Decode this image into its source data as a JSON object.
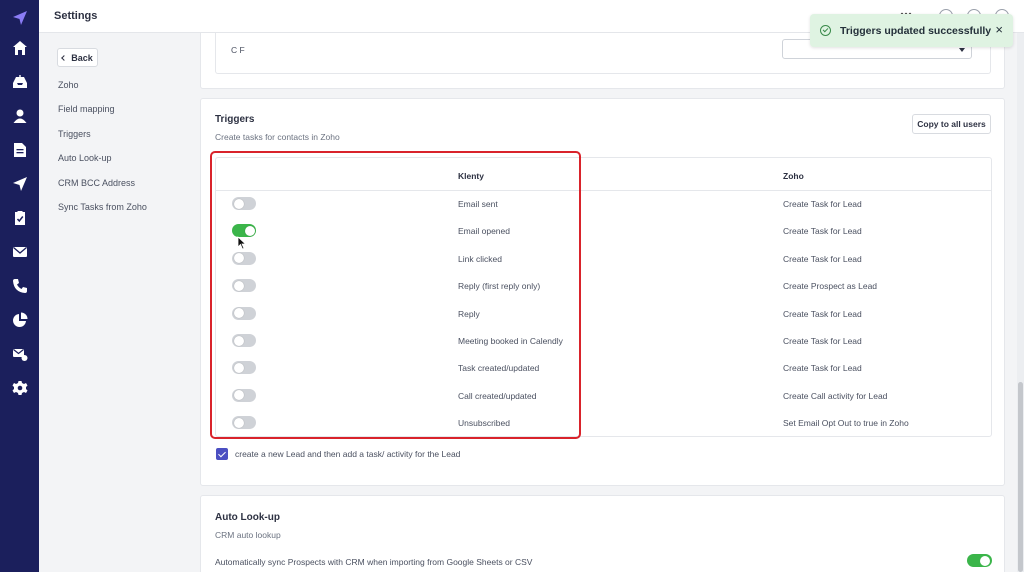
{
  "app": {
    "title": "Settings",
    "brand_color": "#1b1f5c",
    "accent_color": "#3bb54a",
    "highlight_color": "#d9232b"
  },
  "rail": {
    "icons": [
      "logo-icon",
      "home-icon",
      "inbox-icon",
      "user-icon",
      "document-icon",
      "send-icon",
      "clipboard-icon",
      "mail-icon",
      "phone-icon",
      "pie-chart-icon",
      "mail-settings-icon",
      "gear-icon"
    ]
  },
  "toast": {
    "message": "Triggers updated successfully",
    "close": "×"
  },
  "sidenav": {
    "back_label": "Back",
    "items": [
      {
        "label": "Zoho"
      },
      {
        "label": "Field mapping"
      },
      {
        "label": "Triggers"
      },
      {
        "label": "Auto Look-up"
      },
      {
        "label": "CRM BCC Address"
      },
      {
        "label": "Sync Tasks from Zoho"
      }
    ]
  },
  "cf": {
    "label": "C F",
    "select_value": ""
  },
  "triggers": {
    "title": "Triggers",
    "subtitle": "Create tasks for contacts in Zoho",
    "copy_button": "Copy to all users",
    "col_klenty": "Klenty",
    "col_zoho": "Zoho",
    "rows": [
      {
        "klenty": "Email sent",
        "zoho": "Create Task for Lead",
        "on": false
      },
      {
        "klenty": "Email opened",
        "zoho": "Create Task for Lead",
        "on": true
      },
      {
        "klenty": "Link clicked",
        "zoho": "Create Task for Lead",
        "on": false
      },
      {
        "klenty": "Reply (first reply only)",
        "zoho": "Create Prospect as Lead",
        "on": false
      },
      {
        "klenty": "Reply",
        "zoho": "Create Task for Lead",
        "on": false
      },
      {
        "klenty": "Meeting booked in Calendly",
        "zoho": "Create Task for Lead",
        "on": false
      },
      {
        "klenty": "Task created/updated",
        "zoho": "Create Task for Lead",
        "on": false
      },
      {
        "klenty": "Call created/updated",
        "zoho": "Create Call activity for Lead",
        "on": false
      },
      {
        "klenty": "Unsubscribed",
        "zoho": "Set Email Opt Out to true in Zoho",
        "on": false
      }
    ],
    "checkbox_label": "create a new Lead and then add a task/ activity for the Lead",
    "checkbox_checked": true
  },
  "auto_lookup": {
    "title": "Auto Look-up",
    "subtitle": "CRM auto lookup",
    "sync_text": "Automatically sync Prospects with CRM when importing from Google Sheets or CSV",
    "sync_on": true
  }
}
